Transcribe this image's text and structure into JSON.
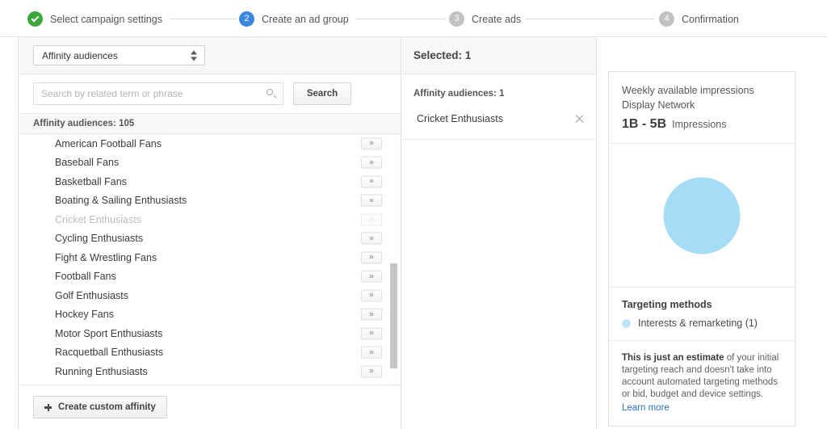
{
  "steps": [
    {
      "num": "",
      "label": "Select campaign settings",
      "state": "done"
    },
    {
      "num": "2",
      "label": "Create an ad group",
      "state": "current"
    },
    {
      "num": "3",
      "label": "Create ads",
      "state": "todo"
    },
    {
      "num": "4",
      "label": "Confirmation",
      "state": "todo"
    }
  ],
  "browse": {
    "category_select_value": "Affinity audiences",
    "search_placeholder": "Search by related term or phrase",
    "search_value": "",
    "search_button_label": "Search",
    "list_header": "Affinity audiences: 105",
    "add_icon_label": "»",
    "items": [
      {
        "label": "American Football Fans",
        "disabled": false
      },
      {
        "label": "Baseball Fans",
        "disabled": false
      },
      {
        "label": "Basketball Fans",
        "disabled": false
      },
      {
        "label": "Boating & Sailing Enthusiasts",
        "disabled": false
      },
      {
        "label": "Cricket Enthusiasts",
        "disabled": true
      },
      {
        "label": "Cycling Enthusiasts",
        "disabled": false
      },
      {
        "label": "Fight & Wrestling Fans",
        "disabled": false
      },
      {
        "label": "Football Fans",
        "disabled": false
      },
      {
        "label": "Golf Enthusiasts",
        "disabled": false
      },
      {
        "label": "Hockey Fans",
        "disabled": false
      },
      {
        "label": "Motor Sport Enthusiasts",
        "disabled": false
      },
      {
        "label": "Racquetball Enthusiasts",
        "disabled": false
      },
      {
        "label": "Running Enthusiasts",
        "disabled": false
      }
    ],
    "custom_button_label": "Create custom affinity"
  },
  "selected": {
    "header": "Selected: 1",
    "group_label": "Affinity audiences: 1",
    "items": [
      {
        "label": "Cricket Enthusiasts"
      }
    ]
  },
  "estimate": {
    "title": "Weekly available impressions",
    "network": "Display Network",
    "value": "1B - 5B",
    "value_unit": "Impressions",
    "bubble_color": "#a5ddf7",
    "targeting_title": "Targeting methods",
    "targeting_rows": [
      {
        "label": "Interests & remarketing (1)",
        "color": "#bfe4f8"
      }
    ],
    "disclaimer_bold": "This is just an estimate",
    "disclaimer_rest": " of your initial targeting reach and doesn't take into account automated targeting methods or bid, budget and device settings.",
    "learn_more": "Learn more"
  }
}
